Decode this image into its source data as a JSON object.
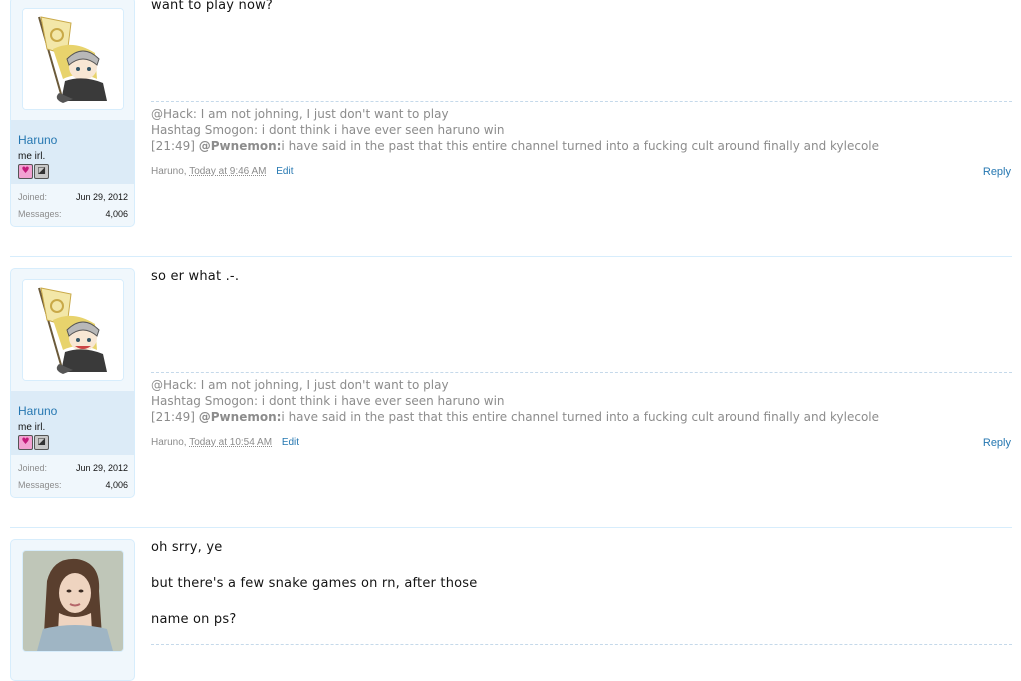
{
  "posts": [
    {
      "user": {
        "name": "Haruno",
        "title": "me irl.",
        "joined_label": "Joined:",
        "joined": "Jun 29, 2012",
        "messages_label": "Messages:",
        "messages": "4,006"
      },
      "message": [
        "want to play now?"
      ],
      "signature": [
        "@Hack: I am not johning, I just don't want to play",
        "Hashtag Smogon: i dont think i have ever seen haruno win"
      ],
      "sig_timestamp": "[21:49] ",
      "sig_mention": "@Pwnemon:",
      "sig_rest": "i have said in the past that this entire channel turned into a fucking cult around finally and kylecole",
      "author": "Haruno,",
      "time": "Today at 9:46 AM",
      "edit": "Edit",
      "reply": "Reply"
    },
    {
      "user": {
        "name": "Haruno",
        "title": "me irl.",
        "joined_label": "Joined:",
        "joined": "Jun 29, 2012",
        "messages_label": "Messages:",
        "messages": "4,006"
      },
      "message": [
        "so er what .-."
      ],
      "signature": [
        "@Hack: I am not johning, I just don't want to play",
        "Hashtag Smogon: i dont think i have ever seen haruno win"
      ],
      "sig_timestamp": "[21:49] ",
      "sig_mention": "@Pwnemon:",
      "sig_rest": "i have said in the past that this entire channel turned into a fucking cult around finally and kylecole",
      "author": "Haruno,",
      "time": "Today at 10:54 AM",
      "edit": "Edit",
      "reply": "Reply"
    },
    {
      "message": [
        "oh srry, ye",
        "but there's a few snake games on rn, after those",
        "name on ps?"
      ]
    }
  ],
  "icons": {
    "heart_badge": "heart-badge-icon",
    "pokemon_badge": "pokemon-badge-icon"
  },
  "colors": {
    "link": "#2577b1",
    "muted": "#8c8c8c",
    "user_panel": "#dcebf7"
  }
}
